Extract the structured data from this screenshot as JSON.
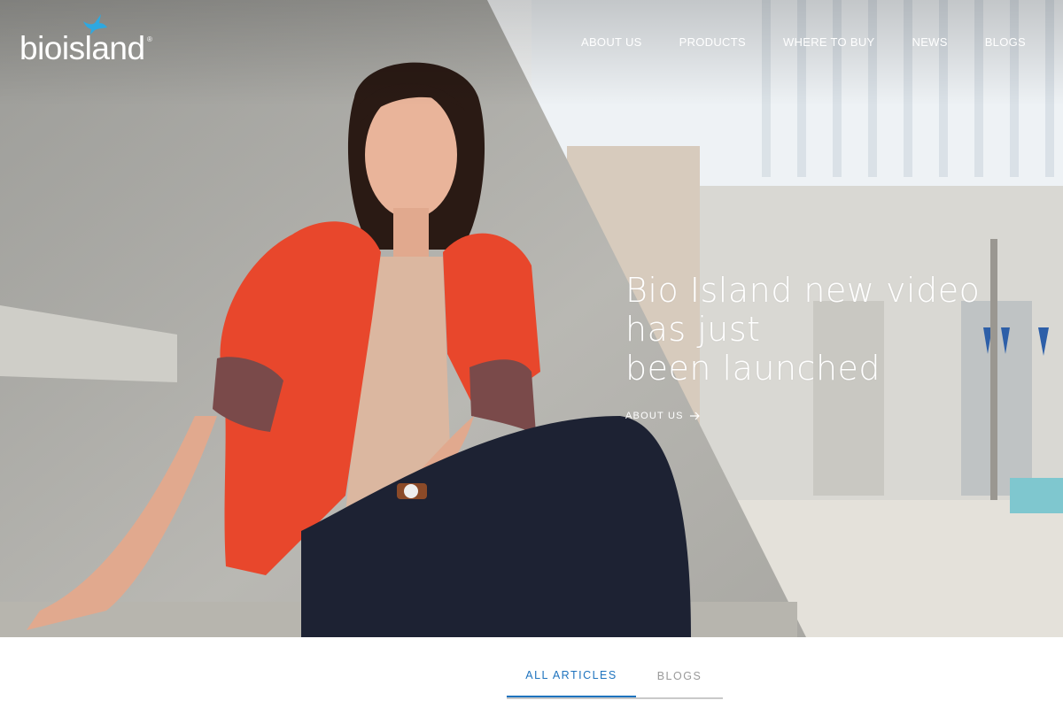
{
  "brand": {
    "logo_text": "bioisland",
    "reg_mark": "®",
    "accent_color": "#2ea8e0"
  },
  "nav": {
    "items": [
      {
        "label": "ABOUT US"
      },
      {
        "label": "PRODUCTS"
      },
      {
        "label": "WHERE TO BUY"
      },
      {
        "label": "NEWS"
      },
      {
        "label": "BLOGS"
      }
    ]
  },
  "hero": {
    "title": "Bio Island new video\nhas just\nbeen launched",
    "link_label": "ABOUT US",
    "link_icon": "arrow-right-icon"
  },
  "tabs": {
    "items": [
      {
        "label": "ALL ARTICLES",
        "active": true
      },
      {
        "label": "BLOGS",
        "active": false
      }
    ],
    "active_color": "#1e73be",
    "inactive_color": "#9a9a9a"
  }
}
